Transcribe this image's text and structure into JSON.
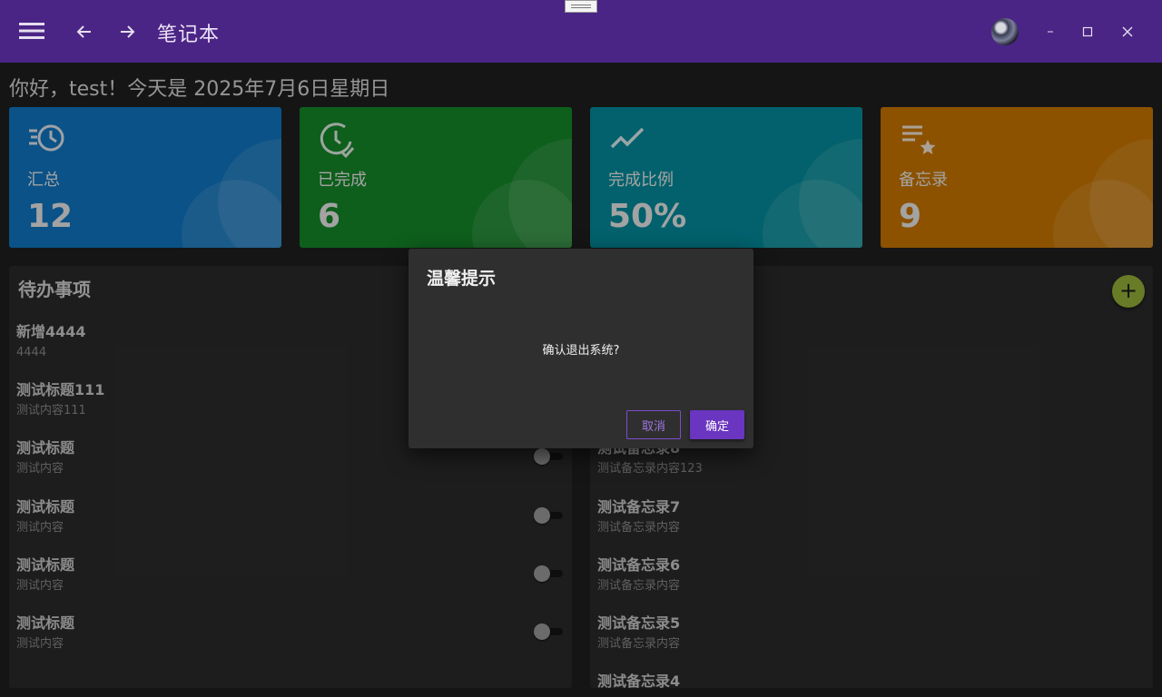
{
  "app": {
    "title": "笔记本"
  },
  "greeting": "你好，test！今天是 2025年7月6日星期日",
  "stats": [
    {
      "icon": "history-icon",
      "label": "汇总",
      "value": "12",
      "color": "#0f79c7"
    },
    {
      "icon": "clock-check-icon",
      "label": "已完成",
      "value": "6",
      "color": "#158b2a"
    },
    {
      "icon": "trend-line-icon",
      "label": "完成比例",
      "value": "50%",
      "color": "#04909f"
    },
    {
      "icon": "list-star-icon",
      "label": "备忘录",
      "value": "9",
      "color": "#cf7a00"
    }
  ],
  "todo": {
    "title": "待办事项",
    "items": [
      {
        "title": "新增4444",
        "desc": "4444"
      },
      {
        "title": "测试标题111",
        "desc": "测试内容111"
      },
      {
        "title": "测试标题",
        "desc": "测试内容"
      },
      {
        "title": "测试标题",
        "desc": "测试内容"
      },
      {
        "title": "测试标题",
        "desc": "测试内容"
      },
      {
        "title": "测试标题",
        "desc": "测试内容"
      }
    ]
  },
  "memo": {
    "add_label": "+",
    "items": [
      {
        "title": "测试备忘录8",
        "desc": "测试备忘录内容123"
      },
      {
        "title": "测试备忘录7",
        "desc": "测试备忘录内容"
      },
      {
        "title": "测试备忘录6",
        "desc": "测试备忘录内容"
      },
      {
        "title": "测试备忘录5",
        "desc": "测试备忘录内容"
      },
      {
        "title": "测试备忘录4",
        "desc": ""
      }
    ]
  },
  "dialog": {
    "title": "温馨提示",
    "message": "确认退出系统?",
    "cancel_label": "取消",
    "ok_label": "确定"
  },
  "colors": {
    "titlebar": "#4a2585",
    "accent": "#6a35c0",
    "add_button": "#9ab53a"
  }
}
